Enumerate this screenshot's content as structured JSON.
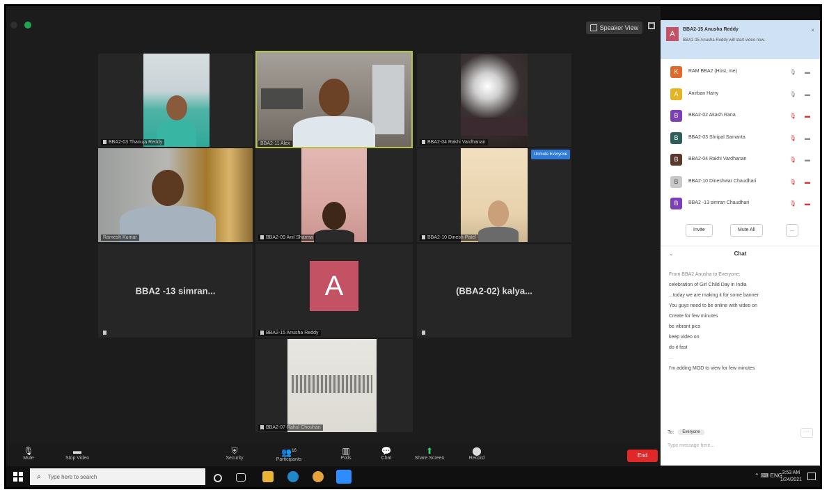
{
  "window": {
    "speaker_view_label": "Speaker View"
  },
  "participants_tiles": [
    {
      "name": "BBA2-03 Thanuja Reddy"
    },
    {
      "name": "BBA2-11 Alex"
    },
    {
      "name": "BBA2-04 Rakhi Vardhanan"
    },
    {
      "name": "Ramesh Kumar"
    },
    {
      "name": "BBA2-09 Anil Sharma"
    },
    {
      "name": "BBA2-10 Dinesh Patel"
    },
    {
      "name": "BBA2 -13 simran...",
      "display": "BBA2 -13 simran..."
    },
    {
      "name": "BBA2-15 Anusha Reddy"
    },
    {
      "name": "(BBA2-02) kalya...",
      "display": "(BBA2-02) kalya..."
    },
    {
      "name": "BBA2-07 Rahul Chouhan"
    }
  ],
  "avatar_letter": "A",
  "spotlight_badge": "Unmute Everyone",
  "toolbar": {
    "mute": "Mute",
    "stop_video": "Stop Video",
    "security": "Security",
    "participants": "Participants",
    "participants_count": "16",
    "polls": "Polls",
    "chat": "Chat",
    "share_screen": "Share Screen",
    "record": "Record",
    "end": "End"
  },
  "notification": {
    "title": "BBA2-15 Anusha Reddy",
    "message": "BBA2-15 Anusha Reddy will start video now."
  },
  "participants_panel": {
    "rows": [
      {
        "initial": "K",
        "name": "RAM BBA2 (Host, me)",
        "color": "#e06a2c",
        "mic_red": false,
        "cam_red": false
      },
      {
        "initial": "A",
        "name": "Anirban Harry",
        "color": "#e4b423",
        "mic_red": false,
        "cam_red": false
      },
      {
        "initial": "B",
        "name": "BBA2-02 Akash Rana",
        "color": "#7b3fb8",
        "mic_red": true,
        "cam_red": true
      },
      {
        "initial": "B",
        "name": "BBA2-03 Shripal Samanta",
        "color": "#2e5f5a",
        "mic_red": true,
        "cam_red": false
      },
      {
        "initial": "B",
        "name": "BBA2-04 Rakhi Vardhanan",
        "color": "#5a3a2a",
        "mic_red": true,
        "cam_red": false
      },
      {
        "initial": "B",
        "name": "BBA2-10 Dineshwar Chaudhari",
        "color": "#c8c8c8",
        "mic_red": true,
        "cam_red": true
      },
      {
        "initial": "B",
        "name": "BBA2 -13 simran Chaudhari",
        "color": "#7b3fb8",
        "mic_red": true,
        "cam_red": true
      }
    ],
    "invite_label": "Invite",
    "mute_all_label": "Mute All",
    "more_label": "..."
  },
  "chat": {
    "header": "Chat",
    "from": "From BBA2 Anusha to Everyone:",
    "lines": [
      "celebration of Girl Child Day in India",
      "...today we are making it for some banner",
      "You guys need to be online with video on",
      "Create for few minutes",
      "be vibrant pics",
      "keep video on",
      "do it fast"
    ],
    "separator": "...",
    "last_line": "I'm adding MOD to view for few minutes",
    "to_label": "To:",
    "to_value": "Everyone",
    "input_placeholder": "Type message here..."
  },
  "taskbar": {
    "search_placeholder": "Type here to search",
    "time": "3:53 AM",
    "date": "1/24/2021",
    "lang": "ENG"
  }
}
